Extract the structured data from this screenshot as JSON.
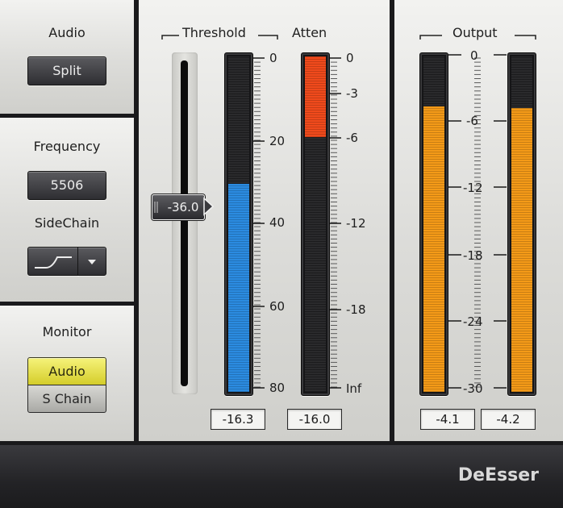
{
  "audio": {
    "heading": "Audio",
    "mode": "Split"
  },
  "frequency": {
    "heading": "Frequency",
    "value": "5506"
  },
  "sidechain": {
    "heading": "SideChain",
    "filter_icon": "highpass-curve-icon",
    "dropdown_icon": "chevron-down-icon"
  },
  "monitor": {
    "heading": "Monitor",
    "options": [
      "Audio",
      "S Chain"
    ],
    "selected": "Audio"
  },
  "threshold": {
    "heading": "Threshold",
    "slider_value": "-36.0",
    "scale": [
      "0",
      "20",
      "40",
      "60",
      "80"
    ],
    "meter_fill": 0.62,
    "meter_color": "#2b8be0",
    "readout": "-16.3"
  },
  "atten": {
    "heading": "Atten",
    "scale": [
      "0",
      "-3",
      "-6",
      "-12",
      "-18",
      "Inf"
    ],
    "meter_fill": 0.24,
    "meter_color": "#f04a1c",
    "readout": "-16.0"
  },
  "output": {
    "heading": "Output",
    "scale": [
      "0",
      "-6",
      "-12",
      "-18",
      "-24",
      "-30"
    ],
    "left_fill": 0.85,
    "right_fill": 0.845,
    "meter_color": "#f49a18",
    "readout_left": "-4.1",
    "readout_right": "-4.2"
  },
  "footer": {
    "title": "DeEsser"
  }
}
